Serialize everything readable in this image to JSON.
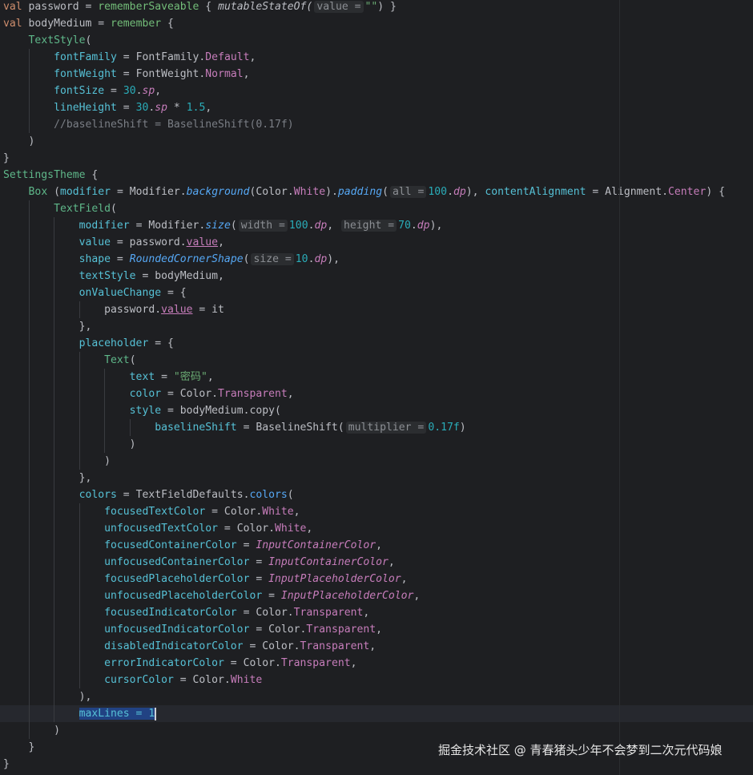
{
  "colors": {
    "background": "#1e1f22",
    "keyword": "#cf8e6d",
    "string": "#6aab73",
    "number": "#2aacb8",
    "property": "#c77dbb",
    "selection": "#214283"
  },
  "code_lines": [
    {
      "indent": 0,
      "t": [
        [
          "val",
          "kw"
        ],
        [
          " password = ",
          ""
        ],
        [
          "rememberSaveable",
          "fn"
        ],
        [
          " { ",
          ""
        ],
        [
          "mutableStateOf(",
          "ifn2"
        ],
        [
          "value =",
          "hint"
        ],
        [
          "\"\"",
          "str"
        ],
        [
          ") }",
          ""
        ]
      ]
    },
    {
      "indent": 0,
      "t": [
        [
          "val",
          "kw"
        ],
        [
          " bodyMedium = ",
          ""
        ],
        [
          "remember",
          "fn"
        ],
        [
          " {",
          ""
        ]
      ]
    },
    {
      "indent": 1,
      "t": [
        [
          "TextStyle",
          "cfn"
        ],
        [
          "(",
          ""
        ]
      ]
    },
    {
      "indent": 2,
      "t": [
        [
          "fontFamily",
          "prm"
        ],
        [
          " = FontFamily.",
          ""
        ],
        [
          "Default",
          "prop"
        ],
        [
          ",",
          ""
        ]
      ]
    },
    {
      "indent": 2,
      "t": [
        [
          "fontWeight",
          "prm"
        ],
        [
          " = FontWeight.",
          ""
        ],
        [
          "Normal",
          "prop"
        ],
        [
          ",",
          ""
        ]
      ]
    },
    {
      "indent": 2,
      "t": [
        [
          "fontSize",
          "prm"
        ],
        [
          " = ",
          ""
        ],
        [
          "30",
          "num"
        ],
        [
          ".",
          ""
        ],
        [
          "sp",
          "iprop"
        ],
        [
          ",",
          ""
        ]
      ]
    },
    {
      "indent": 2,
      "t": [
        [
          "lineHeight",
          "prm"
        ],
        [
          " = ",
          ""
        ],
        [
          "30",
          "num"
        ],
        [
          ".",
          ""
        ],
        [
          "sp",
          "iprop"
        ],
        [
          " * ",
          ""
        ],
        [
          "1.5",
          "num"
        ],
        [
          ",",
          ""
        ]
      ]
    },
    {
      "indent": 2,
      "t": [
        [
          "//baselineShift = BaselineShift(0.17f)",
          "cmt"
        ]
      ]
    },
    {
      "indent": 1,
      "t": [
        [
          ")",
          ""
        ]
      ]
    },
    {
      "indent": 0,
      "t": [
        [
          "}",
          ""
        ]
      ]
    },
    {
      "indent": 0,
      "t": [
        [
          "SettingsTheme",
          "cfn"
        ],
        [
          " {",
          ""
        ]
      ]
    },
    {
      "indent": 1,
      "t": [
        [
          "Box",
          "cfn"
        ],
        [
          " (",
          ""
        ],
        [
          "modifier",
          "prm"
        ],
        [
          " = Modifier.",
          ""
        ],
        [
          "background",
          "ifn"
        ],
        [
          "(Color.",
          ""
        ],
        [
          "White",
          "prop"
        ],
        [
          ").",
          ""
        ],
        [
          "padding",
          "ifn"
        ],
        [
          "(",
          ""
        ],
        [
          "all =",
          "hint"
        ],
        [
          "100",
          "num"
        ],
        [
          ".",
          ""
        ],
        [
          "dp",
          "iprop"
        ],
        [
          "), ",
          ""
        ],
        [
          "contentAlignment",
          "prm"
        ],
        [
          " = Alignment.",
          ""
        ],
        [
          "Center",
          "prop"
        ],
        [
          ") {",
          ""
        ]
      ]
    },
    {
      "indent": 2,
      "t": [
        [
          "TextField",
          "cfn"
        ],
        [
          "(",
          ""
        ]
      ]
    },
    {
      "indent": 3,
      "t": [
        [
          "modifier",
          "prm"
        ],
        [
          " = Modifier.",
          ""
        ],
        [
          "size",
          "ifn"
        ],
        [
          "(",
          ""
        ],
        [
          "width =",
          "hint"
        ],
        [
          "100",
          "num"
        ],
        [
          ".",
          ""
        ],
        [
          "dp",
          "iprop"
        ],
        [
          ", ",
          ""
        ],
        [
          "height =",
          "hint"
        ],
        [
          "70",
          "num"
        ],
        [
          ".",
          ""
        ],
        [
          "dp",
          "iprop"
        ],
        [
          "),",
          ""
        ]
      ]
    },
    {
      "indent": 3,
      "t": [
        [
          "value",
          "prm"
        ],
        [
          " = password.",
          ""
        ],
        [
          "value",
          "ul"
        ],
        [
          ",",
          ""
        ]
      ]
    },
    {
      "indent": 3,
      "t": [
        [
          "shape",
          "prm"
        ],
        [
          " = ",
          ""
        ],
        [
          "RoundedCornerShape",
          "ifn"
        ],
        [
          "(",
          ""
        ],
        [
          "size =",
          "hint"
        ],
        [
          "10",
          "num"
        ],
        [
          ".",
          ""
        ],
        [
          "dp",
          "iprop"
        ],
        [
          "),",
          ""
        ]
      ]
    },
    {
      "indent": 3,
      "t": [
        [
          "textStyle",
          "prm"
        ],
        [
          " = bodyMedium,",
          ""
        ]
      ]
    },
    {
      "indent": 3,
      "t": [
        [
          "onValueChange",
          "prm"
        ],
        [
          " = {",
          ""
        ]
      ]
    },
    {
      "indent": 4,
      "t": [
        [
          "password.",
          ""
        ],
        [
          "value",
          "ul"
        ],
        [
          " = it",
          ""
        ]
      ]
    },
    {
      "indent": 3,
      "t": [
        [
          "},",
          ""
        ]
      ]
    },
    {
      "indent": 3,
      "t": [
        [
          "placeholder",
          "prm"
        ],
        [
          " = {",
          ""
        ]
      ]
    },
    {
      "indent": 4,
      "t": [
        [
          "Text",
          "cfn"
        ],
        [
          "(",
          ""
        ]
      ]
    },
    {
      "indent": 5,
      "t": [
        [
          "text",
          "prm"
        ],
        [
          " = ",
          ""
        ],
        [
          "\"密码\"",
          "str"
        ],
        [
          ",",
          ""
        ]
      ]
    },
    {
      "indent": 5,
      "t": [
        [
          "color",
          "prm"
        ],
        [
          " = Color.",
          ""
        ],
        [
          "Transparent",
          "prop"
        ],
        [
          ",",
          ""
        ]
      ]
    },
    {
      "indent": 5,
      "t": [
        [
          "style",
          "prm"
        ],
        [
          " = bodyMedium.copy(",
          ""
        ]
      ]
    },
    {
      "indent": 6,
      "t": [
        [
          "baselineShift",
          "prm"
        ],
        [
          " = BaselineShift(",
          ""
        ],
        [
          "multiplier =",
          "hint"
        ],
        [
          "0.17f",
          "num"
        ],
        [
          ")",
          ""
        ]
      ]
    },
    {
      "indent": 5,
      "t": [
        [
          ")",
          ""
        ]
      ]
    },
    {
      "indent": 4,
      "t": [
        [
          ")",
          ""
        ]
      ]
    },
    {
      "indent": 3,
      "t": [
        [
          "},",
          ""
        ]
      ]
    },
    {
      "indent": 3,
      "t": [
        [
          "colors",
          "prm"
        ],
        [
          " = TextFieldDefaults.",
          ""
        ],
        [
          "colors",
          "bfn"
        ],
        [
          "(",
          ""
        ]
      ]
    },
    {
      "indent": 4,
      "t": [
        [
          "focusedTextColor",
          "prm"
        ],
        [
          " = Color.",
          ""
        ],
        [
          "White",
          "prop"
        ],
        [
          ",",
          ""
        ]
      ]
    },
    {
      "indent": 4,
      "t": [
        [
          "unfocusedTextColor",
          "prm"
        ],
        [
          " = Color.",
          ""
        ],
        [
          "White",
          "prop"
        ],
        [
          ",",
          ""
        ]
      ]
    },
    {
      "indent": 4,
      "t": [
        [
          "focusedContainerColor",
          "prm"
        ],
        [
          " = ",
          ""
        ],
        [
          "InputContainerColor",
          "iprop"
        ],
        [
          ",",
          ""
        ]
      ]
    },
    {
      "indent": 4,
      "t": [
        [
          "unfocusedContainerColor",
          "prm"
        ],
        [
          " = ",
          ""
        ],
        [
          "InputContainerColor",
          "iprop"
        ],
        [
          ",",
          ""
        ]
      ]
    },
    {
      "indent": 4,
      "t": [
        [
          "focusedPlaceholderColor",
          "prm"
        ],
        [
          " = ",
          ""
        ],
        [
          "InputPlaceholderColor",
          "iprop"
        ],
        [
          ",",
          ""
        ]
      ]
    },
    {
      "indent": 4,
      "t": [
        [
          "unfocusedPlaceholderColor",
          "prm"
        ],
        [
          " = ",
          ""
        ],
        [
          "InputPlaceholderColor",
          "iprop"
        ],
        [
          ",",
          ""
        ]
      ]
    },
    {
      "indent": 4,
      "t": [
        [
          "focusedIndicatorColor",
          "prm"
        ],
        [
          " = Color.",
          ""
        ],
        [
          "Transparent",
          "prop"
        ],
        [
          ",",
          ""
        ]
      ]
    },
    {
      "indent": 4,
      "t": [
        [
          "unfocusedIndicatorColor",
          "prm"
        ],
        [
          " = Color.",
          ""
        ],
        [
          "Transparent",
          "prop"
        ],
        [
          ",",
          ""
        ]
      ]
    },
    {
      "indent": 4,
      "t": [
        [
          "disabledIndicatorColor",
          "prm"
        ],
        [
          " = Color.",
          ""
        ],
        [
          "Transparent",
          "prop"
        ],
        [
          ",",
          ""
        ]
      ]
    },
    {
      "indent": 4,
      "t": [
        [
          "errorIndicatorColor",
          "prm"
        ],
        [
          " = Color.",
          ""
        ],
        [
          "Transparent",
          "prop"
        ],
        [
          ",",
          ""
        ]
      ]
    },
    {
      "indent": 4,
      "t": [
        [
          "cursorColor",
          "prm"
        ],
        [
          " = Color.",
          ""
        ],
        [
          "White",
          "prop"
        ]
      ]
    },
    {
      "indent": 3,
      "t": [
        [
          "),",
          ""
        ]
      ]
    },
    {
      "indent": 3,
      "current": true,
      "t": [
        [
          "maxLines = 1",
          "prm sel"
        ],
        [
          "",
          "caret"
        ]
      ]
    },
    {
      "indent": 2,
      "t": [
        [
          ")",
          ""
        ]
      ]
    },
    {
      "indent": 1,
      "t": [
        [
          "}",
          ""
        ]
      ]
    },
    {
      "indent": 0,
      "t": [
        [
          "}",
          ""
        ]
      ]
    }
  ],
  "watermark": "掘金技术社区 @ 青春猪头少年不会梦到二次元代码娘"
}
